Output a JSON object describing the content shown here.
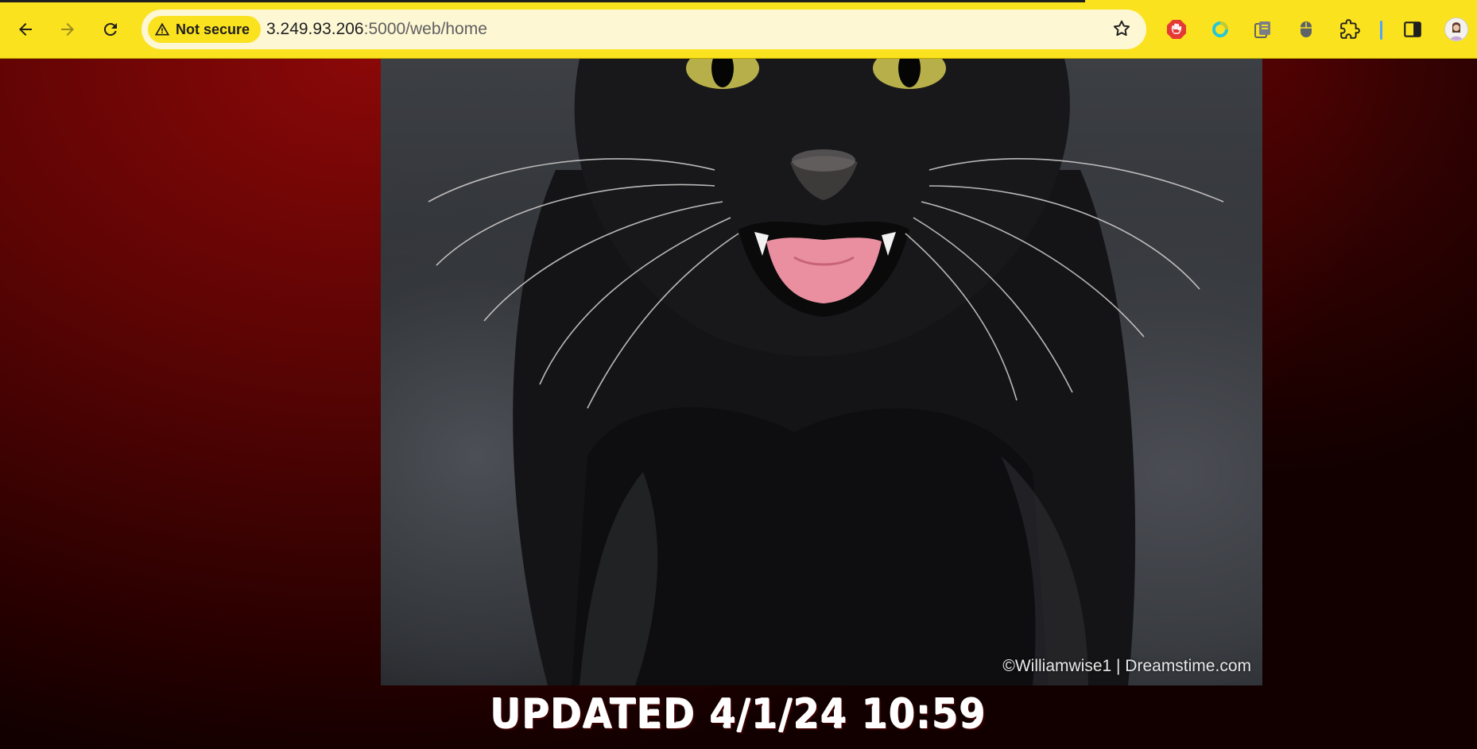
{
  "browser": {
    "security_label": "Not secure",
    "url_host": "3.249.93.206",
    "url_path": ":5000/web/home",
    "nav": {
      "back_icon": "arrow-left-icon",
      "forward_icon": "arrow-right-icon",
      "reload_icon": "reload-icon"
    },
    "extensions": [
      {
        "name": "adblock-extension-icon",
        "color": "#e53935"
      },
      {
        "name": "ring-extension-icon",
        "color": "#26c6da"
      },
      {
        "name": "copy-extension-icon",
        "color": "#5f6368"
      },
      {
        "name": "mouse-extension-icon",
        "color": "#5f6368"
      },
      {
        "name": "puzzle-extensions-icon",
        "color": "#1f1f1f"
      },
      {
        "name": "side-panel-icon",
        "color": "#1f1f1f"
      }
    ],
    "accent_color": "#fbe21e"
  },
  "page": {
    "photo_credit": "©Williamwise1 | Dreamstime.com",
    "caption": "UPDATED 4/1/24 10:59",
    "image_subject": "black-cat-hissing-photo"
  }
}
